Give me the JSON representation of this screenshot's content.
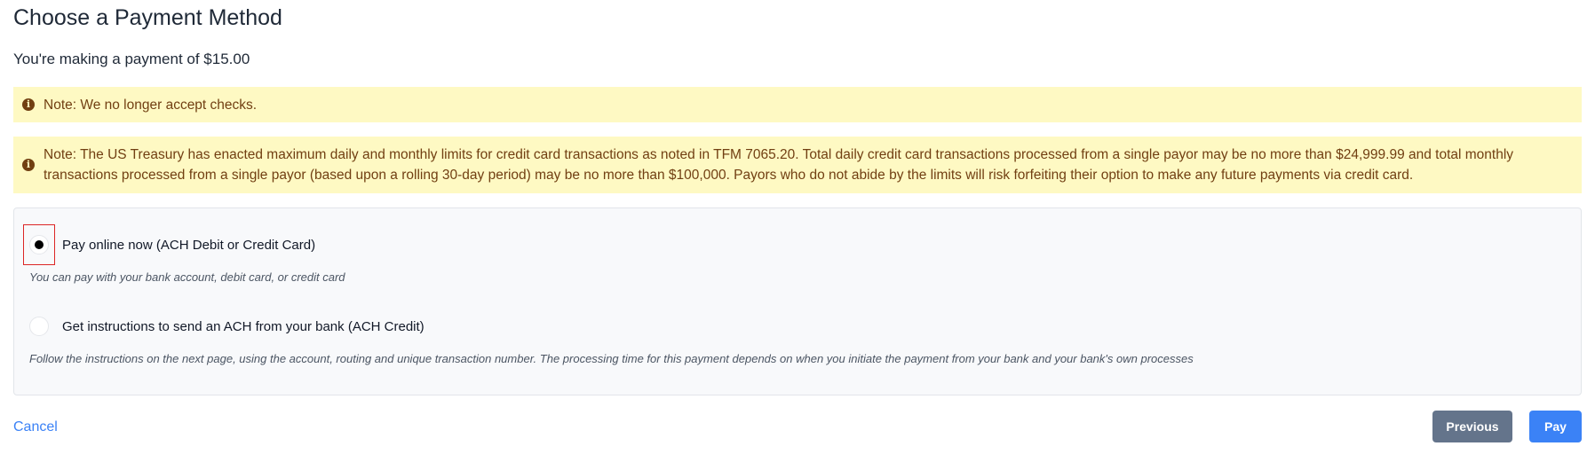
{
  "header": {
    "title": "Choose a Payment Method",
    "subtitle": "You're making a payment of $15.00"
  },
  "alerts": [
    {
      "icon": "info-circle-icon",
      "text": "Note: We no longer accept checks."
    },
    {
      "icon": "info-circle-icon",
      "text": "Note: The US Treasury has enacted maximum daily and monthly limits for credit card transactions as noted in TFM 7065.20. Total daily credit card transactions processed from a single payor may be no more than $24,999.99 and total monthly transactions processed from a single payor (based upon a rolling 30-day period) may be no more than $100,000. Payors who do not abide by the limits will risk forfeiting their option to make any future payments via credit card."
    }
  ],
  "payment_options": [
    {
      "label": "Pay online now (ACH Debit or Credit Card)",
      "help": "You can pay with your bank account, debit card, or credit card",
      "selected": true
    },
    {
      "label": "Get instructions to send an ACH from your bank (ACH Credit)",
      "help": "Follow the instructions on the next page, using the account, routing and unique transaction number. The processing time for this payment depends on when you initiate the payment from your bank and your bank's own processes",
      "selected": false
    }
  ],
  "actions": {
    "cancel_label": "Cancel",
    "previous_label": "Previous",
    "pay_label": "Pay"
  },
  "colors": {
    "alert_bg": "#fef9c3",
    "alert_text": "#713f12",
    "primary": "#3b82f6",
    "secondary": "#64748b",
    "focus_outline": "#dc2626"
  }
}
